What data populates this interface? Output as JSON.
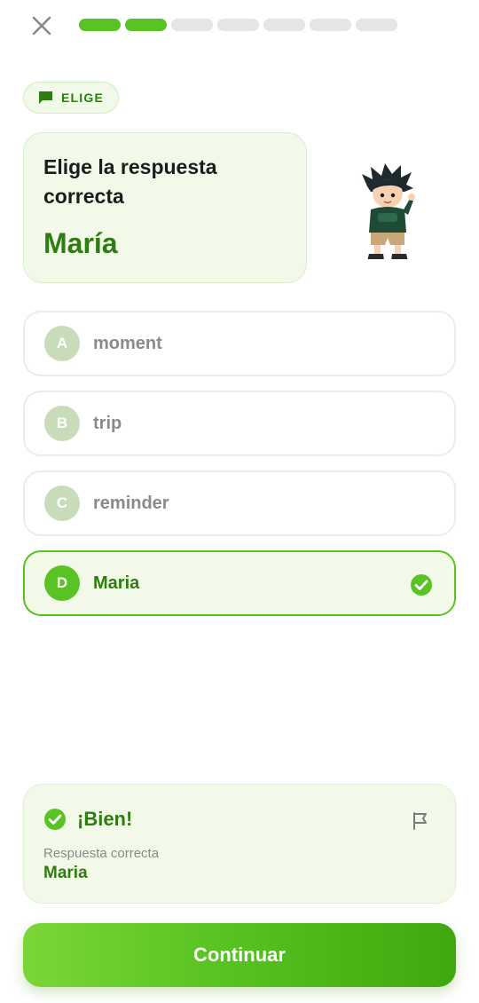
{
  "progress": {
    "total_segments": 7,
    "completed_segments": 2,
    "accent_color": "#58c322"
  },
  "badge": {
    "label": "ELIGE",
    "icon": "chat-bubble-icon"
  },
  "prompt": {
    "instruction": "Elige la respuesta correcta",
    "word": "María"
  },
  "options": [
    {
      "letter": "A",
      "text": "moment",
      "state": "default"
    },
    {
      "letter": "B",
      "text": "trip",
      "state": "default"
    },
    {
      "letter": "C",
      "text": "reminder",
      "state": "default"
    },
    {
      "letter": "D",
      "text": "Maria",
      "state": "correct"
    }
  ],
  "feedback": {
    "title": "¡Bien!",
    "subtitle": "Respuesta correcta",
    "answer": "Maria",
    "icons": [
      "check-circle-icon",
      "flag-icon"
    ]
  },
  "continue_button": {
    "label": "Continuar"
  },
  "colors": {
    "accent": "#58c322",
    "dark_green": "#2f7d12",
    "light_green_bg": "#f2f9e9"
  }
}
